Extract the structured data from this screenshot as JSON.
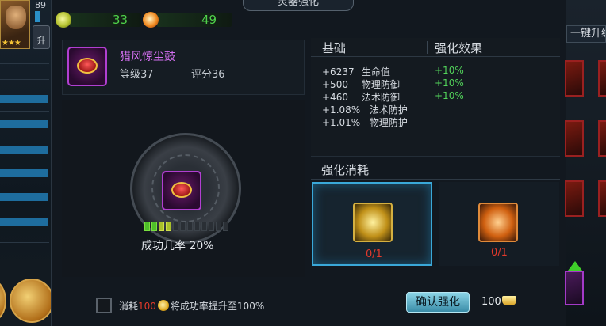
{
  "header": {
    "title": "灵器强化"
  },
  "left_strip": {
    "hero_level": "89",
    "stars": "★★★",
    "upgrade_label": "升"
  },
  "resources": [
    {
      "icon": "green-orb-icon",
      "value": "33"
    },
    {
      "icon": "fire-orb-icon",
      "value": "49"
    }
  ],
  "item": {
    "name": "猎风惊尘鼓",
    "level": "等级37",
    "score": "评分36"
  },
  "stats": {
    "base_header": "基础",
    "effect_header": "强化效果",
    "rows": [
      {
        "value": "+6237",
        "name": "生命值",
        "effect": "+10%"
      },
      {
        "value": "+500",
        "name": "物理防御",
        "effect": "+10%"
      },
      {
        "value": "+460",
        "name": "法术防御",
        "effect": "+10%"
      },
      {
        "value": "+1.08%",
        "name": "法术防护",
        "effect": ""
      },
      {
        "value": "+1.01%",
        "name": "物理防护",
        "effect": ""
      }
    ]
  },
  "success": {
    "rate_label": "成功几率 20%",
    "segments_total": 12,
    "segments_filled": 4
  },
  "cost": {
    "title": "强化消耗",
    "materials": [
      {
        "icon": "gold-rank-stone-icon",
        "count": "0/1",
        "selected": true
      },
      {
        "icon": "orange-rank-stone-icon",
        "count": "0/1",
        "selected": false
      }
    ]
  },
  "boost": {
    "prefix": "消耗",
    "amount": "100",
    "suffix": "将成功率提升至100%"
  },
  "confirm": {
    "label": "确认强化",
    "price": "100"
  },
  "right_strip": {
    "onekey_label": "一键升级"
  },
  "colors": {
    "accent_blue": "#3aa8d8",
    "positive_green": "#52d35a",
    "warning_red": "#e2392c",
    "item_purple": "#d36ff0"
  }
}
